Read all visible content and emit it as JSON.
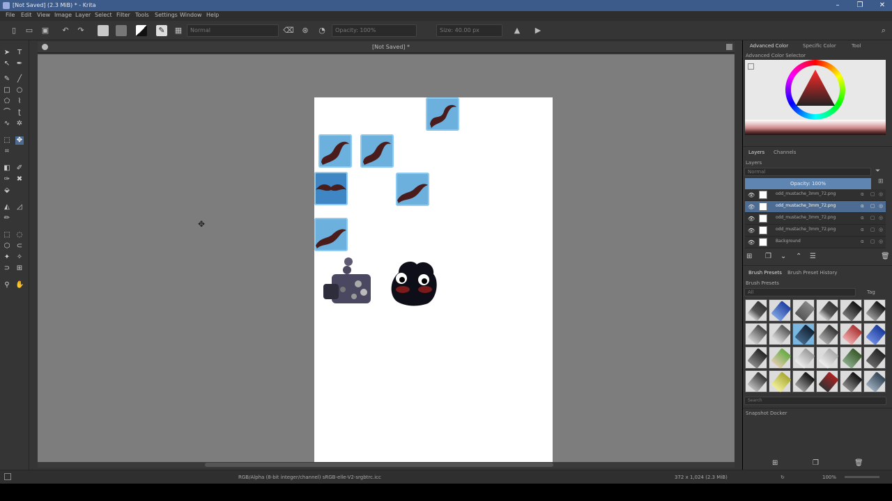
{
  "window": {
    "title": "[Not Saved]  (2.3 MiB)  * - Krita",
    "controls": [
      "–",
      "❐",
      "✕"
    ]
  },
  "menu": [
    "File",
    "Edit",
    "View",
    "Image",
    "Layer",
    "Select",
    "Filter",
    "Tools",
    "Settings",
    "Window",
    "Help"
  ],
  "toolbar": {
    "blend_mode": "Normal",
    "opacity": "Opacity: 100%",
    "size": "Size: 40.00 px"
  },
  "document": {
    "tab_title": "[Not Saved] *"
  },
  "dockers": {
    "color_tabs": [
      "Advanced Color",
      "Specific Color",
      "Tool"
    ],
    "color_title": "Advanced Color Selector",
    "layer_tabs": [
      "Layers",
      "Channels"
    ],
    "layers_title": "Layers",
    "layer_blend": "Normal",
    "layer_opacity": "Opacity:  100%",
    "layers": [
      {
        "name": "odd_mustache_3mm_72.png",
        "selected": false
      },
      {
        "name": "odd_mustache_3mm_72.png",
        "selected": true
      },
      {
        "name": "odd_mustache_3mm_72.png",
        "selected": false
      },
      {
        "name": "odd_mustache_3mm_72.png",
        "selected": false
      },
      {
        "name": "Background",
        "selected": false
      }
    ],
    "brush_tabs": [
      "Brush Presets",
      "Brush Preset History"
    ],
    "brush_title": "Brush Presets",
    "brush_filter": "All",
    "brush_tag": "Tag",
    "brush_search": "Search",
    "snapshot_title": "Snapshot Docker"
  },
  "statusbar": {
    "color_info": "RGB/Alpha (8-bit integer/channel)  sRGB-elle-V2-srgbtrc.icc",
    "dimensions": "372 x 1,024 (2.3 MiB)",
    "zoom": "100%"
  },
  "colors": {
    "accent": "#4d6c94",
    "titlebar": "#3c5a8a",
    "canvas_bg": "#7d7d7d",
    "sticker": "#6cb0dd"
  }
}
